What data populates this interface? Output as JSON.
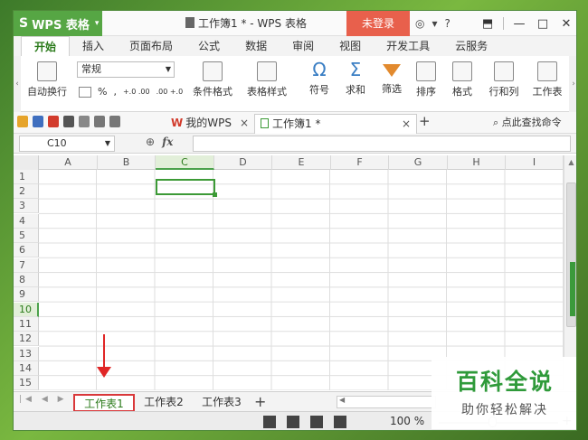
{
  "titlebar": {
    "app_name": "WPS 表格",
    "doc_title": "工作簿1 * - WPS 表格",
    "login_label": "未登录",
    "help_label": "?"
  },
  "menu_tabs": [
    "开始",
    "插入",
    "页面布局",
    "公式",
    "数据",
    "审阅",
    "视图",
    "开发工具",
    "云服务"
  ],
  "ribbon": {
    "wrap_text": "自动换行",
    "number_format": "常规",
    "percent": "%",
    "comma": ",",
    "dec_increase": "+.0 .00",
    "dec_decrease": ".00 +.0",
    "conditional_format": "条件格式",
    "table_style": "表格样式",
    "symbol": "符号",
    "sum": "求和",
    "filter": "筛选",
    "sort": "排序",
    "format": "格式",
    "row_col": "行和列",
    "worksheet": "工作表"
  },
  "doc_tabs": {
    "mywps_label": "我的WPS",
    "book_label": "工作簿1 *",
    "search_cmd": "点此查找命令"
  },
  "formula_bar": {
    "name_box": "C10",
    "fx_label": "fx"
  },
  "columns": [
    "A",
    "B",
    "C",
    "D",
    "E",
    "F",
    "G",
    "H",
    "I"
  ],
  "rows": [
    "1",
    "2",
    "3",
    "4",
    "5",
    "6",
    "7",
    "8",
    "9",
    "10",
    "11",
    "12",
    "13",
    "14",
    "15"
  ],
  "selected": {
    "column": "C",
    "row": "10"
  },
  "sheets": [
    "工作表1",
    "工作表2",
    "工作表3"
  ],
  "status": {
    "zoom": "100 %"
  },
  "watermark": {
    "title": "百科全说",
    "subtitle": "助你轻松解决"
  },
  "colors": {
    "wps_green": "#56a644",
    "login_red": "#e8604c",
    "accent_green": "#3c9a36",
    "annotation_red": "#e02626"
  }
}
